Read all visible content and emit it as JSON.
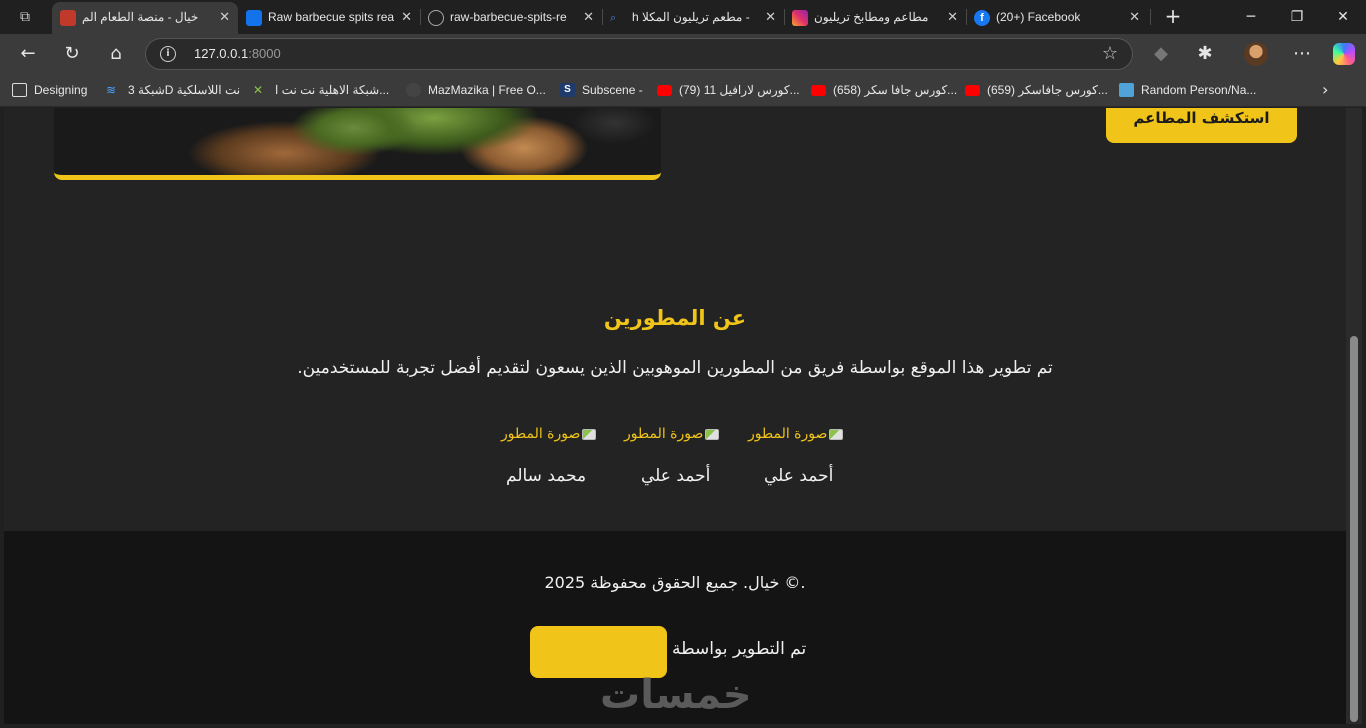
{
  "tabs": [
    {
      "title": "خيال - منصة الطعام الم",
      "active": true,
      "icon": "restaurant-icon",
      "color": "#c0392b"
    },
    {
      "title": "Raw barbecue spits rea",
      "active": false,
      "icon": "freepik-icon",
      "color": "#1273eb"
    },
    {
      "title": "raw-barbecue-spits-re",
      "active": false,
      "icon": "globe-icon",
      "color": "#888888"
    },
    {
      "title": "h مطعم تريليون المكلا -",
      "active": false,
      "icon": "search-icon",
      "color": "#4a7bd6"
    },
    {
      "title": "مطاعم ومطابخ تريليون",
      "active": false,
      "icon": "instagram-icon",
      "color": "#e1306c"
    },
    {
      "title": "(20+) Facebook",
      "active": false,
      "icon": "facebook-icon",
      "color": "#1877f2"
    }
  ],
  "address_bar": {
    "host": "127.0.0.1",
    "port": ":8000"
  },
  "bookmarks": [
    {
      "label": "Designing",
      "icon": "folder-icon"
    },
    {
      "label": "شبكة 3D نت اللاسلكية",
      "icon": "wifi-icon"
    },
    {
      "label": "شبكة الاهلية نت نت ا...",
      "icon": "network-icon"
    },
    {
      "label": "MazMazika | Free O...",
      "icon": "music-icon"
    },
    {
      "label": "Subscene -",
      "icon": "subscene-icon"
    },
    {
      "label": "(79) كورس لارافيل 11...",
      "icon": "youtube-icon"
    },
    {
      "label": "(658) كورس جافا سكر...",
      "icon": "youtube-icon"
    },
    {
      "label": "(659) كورس جافاسكر...",
      "icon": "youtube-icon"
    },
    {
      "label": "Random Person/Na...",
      "icon": "person-icon"
    }
  ],
  "hero": {
    "explore_label": "استكشف المطاعم"
  },
  "about": {
    "title": "عن المطورين",
    "text": ".تم تطوير هذا الموقع بواسطة فريق من المطورين الموهوبين الذين يسعون لتقديم أفضل تجربة للمستخدمين",
    "developers": [
      {
        "image_alt": "صورة المطور",
        "name": "أحمد علي"
      },
      {
        "image_alt": "صورة المطور",
        "name": "أحمد علي"
      },
      {
        "image_alt": "صورة المطور",
        "name": "محمد سالم"
      }
    ]
  },
  "footer": {
    "copyright": "خيال. جميع الحقوق محفوظة 2025 ©.",
    "developed_by": "تم التطوير بواسطة",
    "watermark": "خمسات"
  },
  "colors": {
    "accent": "#f0c419",
    "page_bg": "#232323",
    "footer_bg": "#141414"
  }
}
